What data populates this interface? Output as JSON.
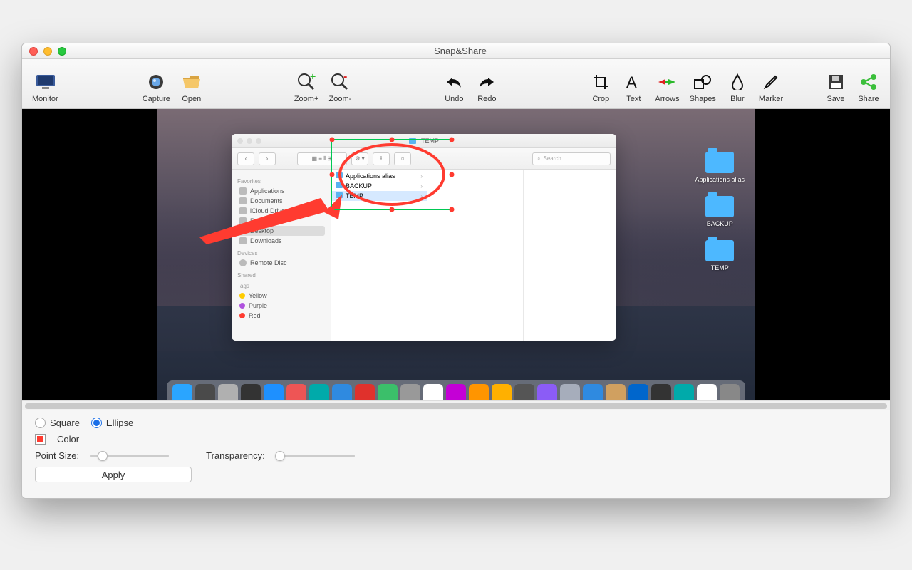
{
  "window": {
    "title": "Snap&Share"
  },
  "toolbar": {
    "monitor": "Monitor",
    "capture": "Capture",
    "open": "Open",
    "zoom_in": "Zoom+",
    "zoom_out": "Zoom-",
    "undo": "Undo",
    "redo": "Redo",
    "crop": "Crop",
    "text": "Text",
    "arrows": "Arrows",
    "shapes": "Shapes",
    "blur": "Blur",
    "marker": "Marker",
    "save": "Save",
    "share": "Share"
  },
  "finder": {
    "title": "TEMP",
    "search_placeholder": "Search",
    "sidebar": {
      "favorites_head": "Favorites",
      "items": [
        "Applications",
        "Documents",
        "iCloud Drive",
        "Recents",
        "Desktop",
        "Downloads"
      ],
      "devices_head": "Devices",
      "devices": [
        "Remote Disc"
      ],
      "shared_head": "Shared",
      "tags_head": "Tags",
      "tags": [
        {
          "label": "Yellow",
          "color": "#ffcc00"
        },
        {
          "label": "Purple",
          "color": "#af52de"
        },
        {
          "label": "Red",
          "color": "#ff3b30"
        }
      ]
    },
    "column": [
      {
        "label": "Applications alias"
      },
      {
        "label": "BACKUP"
      },
      {
        "label": "TEMP"
      }
    ]
  },
  "desktop_icons": [
    "Applications alias",
    "BACKUP",
    "TEMP"
  ],
  "panel": {
    "square": "Square",
    "ellipse": "Ellipse",
    "color": "Color",
    "point_size": "Point Size:",
    "transparency": "Transparency:",
    "apply": "Apply",
    "selected_shape": "ellipse",
    "point_size_value": 15,
    "transparency_value": 0,
    "swatch_color": "#ff3b30"
  },
  "dock_colors": [
    "#2aa5ff",
    "#4a4a4a",
    "#b0b0b0",
    "#333",
    "#1e90ff",
    "#e55",
    "#0aa",
    "#2f8ae0",
    "#e0312c",
    "#3bbf6a",
    "#999",
    "#fff",
    "#c400d6",
    "#ff9500",
    "#ffb000",
    "#555",
    "#8b5cf6",
    "#a6adbb",
    "#2f8ae0",
    "#d0a060",
    "#06c",
    "#333",
    "#0aa",
    "#fff",
    "#888"
  ]
}
